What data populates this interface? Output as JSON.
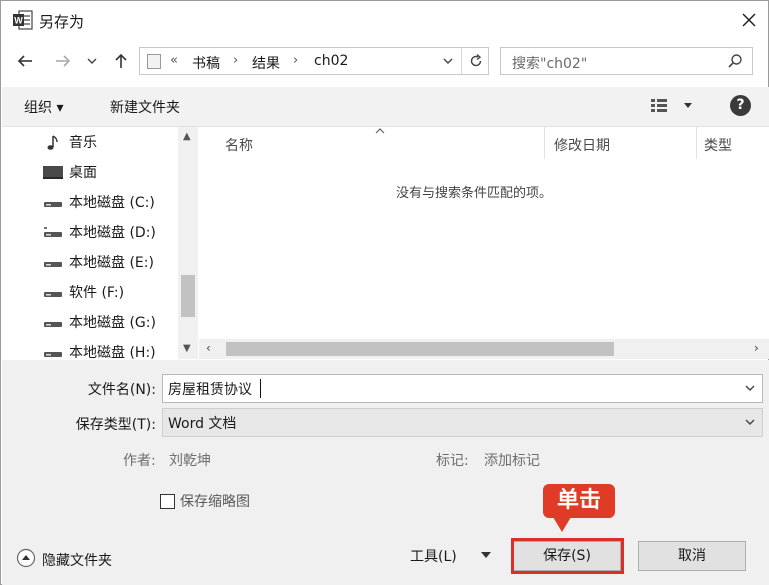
{
  "window": {
    "title": "另存为",
    "close_icon": "close-icon",
    "app_icon": "word-icon"
  },
  "nav": {
    "back_icon": "arrow-left-icon",
    "forward_icon": "arrow-right-icon",
    "recent_icon": "chevron-down-icon",
    "up_icon": "arrow-up-icon",
    "breadcrumb_prefix": "«",
    "breadcrumbs": [
      "书稿",
      "结果",
      "ch02"
    ],
    "refresh_icon": "refresh-icon",
    "search_placeholder": "搜索\"ch02\""
  },
  "toolbar": {
    "organize": "组织 ▾",
    "new_folder": "新建文件夹",
    "help": "?"
  },
  "sidebar": {
    "items": [
      {
        "label": "音乐",
        "icon": "music-note-icon"
      },
      {
        "label": "桌面",
        "icon": "desktop-icon"
      },
      {
        "label": "本地磁盘 (C:)",
        "icon": "drive-icon"
      },
      {
        "label": "本地磁盘 (D:)",
        "icon": "drive-icon"
      },
      {
        "label": "本地磁盘 (E:)",
        "icon": "drive-icon"
      },
      {
        "label": "软件 (F:)",
        "icon": "drive-icon"
      },
      {
        "label": "本地磁盘 (G:)",
        "icon": "drive-icon"
      },
      {
        "label": "本地磁盘 (H:)",
        "icon": "drive-icon"
      }
    ]
  },
  "filelist": {
    "columns": [
      "名称",
      "修改日期",
      "类型"
    ],
    "empty_message": "没有与搜索条件匹配的项。"
  },
  "form": {
    "filename_label": "文件名(N):",
    "filename_value": "房屋租赁协议",
    "filetype_label": "保存类型(T):",
    "filetype_value": "Word 文档",
    "author_label": "作者:",
    "author_value": "刘乾坤",
    "tags_label": "标记:",
    "tags_value": "添加标记",
    "thumbnail_label": "保存缩略图",
    "thumbnail_checked": false,
    "hide_folders": "隐藏文件夹",
    "tools": "工具(L)",
    "save": "保存(S)",
    "cancel": "取消"
  },
  "annotation": {
    "callout": "单击",
    "color": "#e03b26"
  }
}
